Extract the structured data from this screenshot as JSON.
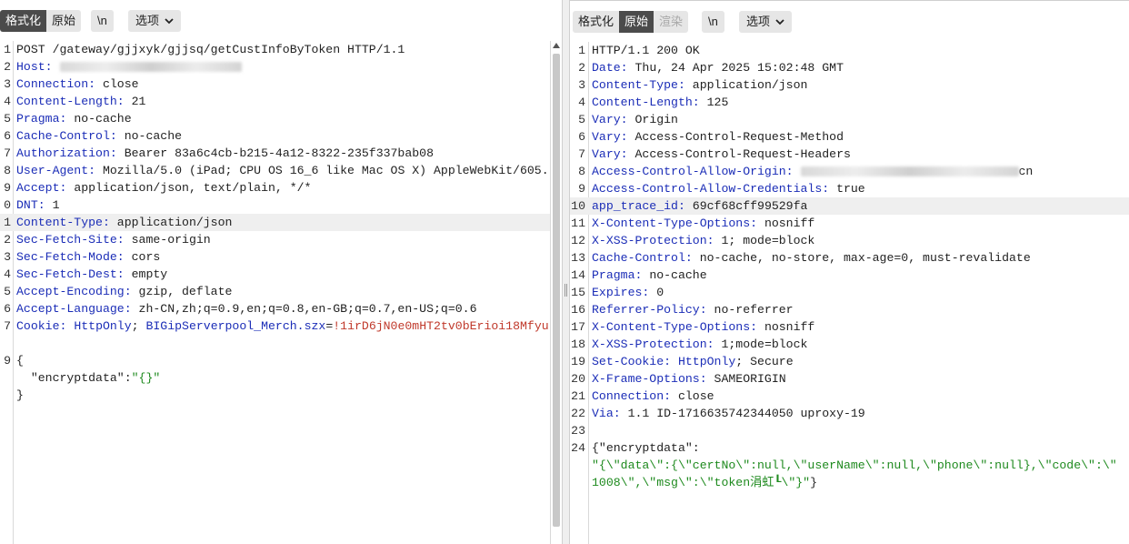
{
  "left": {
    "tabs": {
      "pretty": "格式化",
      "raw": "原始"
    },
    "newline_toggle": "\\n",
    "options": "选项",
    "lines": [
      {
        "n": "1",
        "parts": [
          {
            "t": "POST /gateway/gjjxyk/gjjsq/getCustInfoByToken HTTP/1.1",
            "c": ""
          }
        ]
      },
      {
        "n": "2",
        "parts": [
          {
            "t": "Host:",
            "c": "key"
          },
          {
            "t": " ",
            "c": ""
          },
          {
            "blur": 200
          }
        ]
      },
      {
        "n": "3",
        "parts": [
          {
            "t": "Connection:",
            "c": "key"
          },
          {
            "t": " close",
            "c": ""
          }
        ]
      },
      {
        "n": "4",
        "parts": [
          {
            "t": "Content-Length:",
            "c": "key"
          },
          {
            "t": " 21",
            "c": ""
          }
        ]
      },
      {
        "n": "5",
        "parts": [
          {
            "t": "Pragma:",
            "c": "key"
          },
          {
            "t": " no-cache",
            "c": ""
          }
        ]
      },
      {
        "n": "6",
        "parts": [
          {
            "t": "Cache-Control:",
            "c": "key"
          },
          {
            "t": " no-cache",
            "c": ""
          }
        ]
      },
      {
        "n": "7",
        "parts": [
          {
            "t": "Authorization:",
            "c": "key"
          },
          {
            "t": " Bearer 83a6c4cb-b215-4a12-8322-235f337bab08",
            "c": ""
          }
        ]
      },
      {
        "n": "8",
        "parts": [
          {
            "t": "User-Agent:",
            "c": "key"
          },
          {
            "t": " Mozilla/5.0 (iPad; CPU OS 16_6 like Mac OS X) AppleWebKit/605.",
            "c": ""
          }
        ]
      },
      {
        "n": "9",
        "parts": [
          {
            "t": "Accept:",
            "c": "key"
          },
          {
            "t": " application/json, text/plain, */*",
            "c": ""
          }
        ]
      },
      {
        "n": "0",
        "parts": [
          {
            "t": "DNT:",
            "c": "key"
          },
          {
            "t": " 1",
            "c": ""
          }
        ]
      },
      {
        "n": "1",
        "hl": true,
        "parts": [
          {
            "t": "Content-Type:",
            "c": "key"
          },
          {
            "t": " application/json",
            "c": ""
          }
        ]
      },
      {
        "n": "2",
        "parts": [
          {
            "t": "Sec-Fetch-Site:",
            "c": "key"
          },
          {
            "t": " same-origin",
            "c": ""
          }
        ]
      },
      {
        "n": "3",
        "parts": [
          {
            "t": "Sec-Fetch-Mode:",
            "c": "key"
          },
          {
            "t": " cors",
            "c": ""
          }
        ]
      },
      {
        "n": "4",
        "parts": [
          {
            "t": "Sec-Fetch-Dest:",
            "c": "key"
          },
          {
            "t": " empty",
            "c": ""
          }
        ]
      },
      {
        "n": "5",
        "parts": [
          {
            "t": "Accept-Encoding:",
            "c": "key"
          },
          {
            "t": " gzip, deflate",
            "c": ""
          }
        ]
      },
      {
        "n": "6",
        "parts": [
          {
            "t": "Accept-Language:",
            "c": "key"
          },
          {
            "t": " zh-CN,zh;q=0.9,en;q=0.8,en-GB;q=0.7,en-US;q=0.6",
            "c": ""
          }
        ]
      },
      {
        "n": "7",
        "parts": [
          {
            "t": "Cookie:",
            "c": "key"
          },
          {
            "t": " ",
            "c": ""
          },
          {
            "t": "HttpOnly",
            "c": "ck"
          },
          {
            "t": "; ",
            "c": ""
          },
          {
            "t": "BIGipServerpool_Merch.szx",
            "c": "ck"
          },
          {
            "t": "=",
            "c": ""
          },
          {
            "t": "!1irD6jN0e0mHT2tv0bErioi18Mfyu",
            "c": "cv"
          }
        ]
      },
      {
        "n": "",
        "parts": []
      },
      {
        "n": "9",
        "parts": [
          {
            "t": "{",
            "c": ""
          }
        ]
      },
      {
        "n": "",
        "parts": [
          {
            "t": "  \"encryptdata\":",
            "c": ""
          },
          {
            "t": "\"{}\"",
            "c": "str"
          }
        ]
      },
      {
        "n": "",
        "parts": [
          {
            "t": "}",
            "c": ""
          }
        ]
      }
    ]
  },
  "right": {
    "tabs": {
      "pretty": "格式化",
      "raw": "原始",
      "render": "渲染"
    },
    "newline_toggle": "\\n",
    "options": "选项",
    "lines": [
      {
        "n": "1",
        "parts": [
          {
            "t": "HTTP/1.1 200 OK",
            "c": ""
          }
        ]
      },
      {
        "n": "2",
        "parts": [
          {
            "t": "Date:",
            "c": "key"
          },
          {
            "t": " Thu, 24 Apr 2025 15:02:48 GMT",
            "c": ""
          }
        ]
      },
      {
        "n": "3",
        "parts": [
          {
            "t": "Content-Type:",
            "c": "key"
          },
          {
            "t": " application/json",
            "c": ""
          }
        ]
      },
      {
        "n": "4",
        "parts": [
          {
            "t": "Content-Length:",
            "c": "key"
          },
          {
            "t": " 125",
            "c": ""
          }
        ]
      },
      {
        "n": "5",
        "parts": [
          {
            "t": "Vary:",
            "c": "key"
          },
          {
            "t": " Origin",
            "c": ""
          }
        ]
      },
      {
        "n": "6",
        "parts": [
          {
            "t": "Vary:",
            "c": "key"
          },
          {
            "t": " Access-Control-Request-Method",
            "c": ""
          }
        ]
      },
      {
        "n": "7",
        "parts": [
          {
            "t": "Vary:",
            "c": "key"
          },
          {
            "t": " Access-Control-Request-Headers",
            "c": ""
          }
        ]
      },
      {
        "n": "8",
        "parts": [
          {
            "t": "Access-Control-Allow-Origin:",
            "c": "key"
          },
          {
            "t": " ",
            "c": ""
          },
          {
            "blur": 240
          },
          {
            "t": "cn",
            "c": ""
          }
        ]
      },
      {
        "n": "9",
        "parts": [
          {
            "t": "Access-Control-Allow-Credentials:",
            "c": "key"
          },
          {
            "t": " true",
            "c": ""
          }
        ]
      },
      {
        "n": "10",
        "hl": true,
        "parts": [
          {
            "t": "app_trace_id:",
            "c": "key"
          },
          {
            "t": " 69cf68cff99529fa",
            "c": ""
          }
        ]
      },
      {
        "n": "11",
        "parts": [
          {
            "t": "X-Content-Type-Options:",
            "c": "key"
          },
          {
            "t": " nosniff",
            "c": ""
          }
        ]
      },
      {
        "n": "12",
        "parts": [
          {
            "t": "X-XSS-Protection:",
            "c": "key"
          },
          {
            "t": " 1; mode=block",
            "c": ""
          }
        ]
      },
      {
        "n": "13",
        "parts": [
          {
            "t": "Cache-Control:",
            "c": "key"
          },
          {
            "t": " no-cache, no-store, max-age=0, must-revalidate",
            "c": ""
          }
        ]
      },
      {
        "n": "14",
        "parts": [
          {
            "t": "Pragma:",
            "c": "key"
          },
          {
            "t": " no-cache",
            "c": ""
          }
        ]
      },
      {
        "n": "15",
        "parts": [
          {
            "t": "Expires:",
            "c": "key"
          },
          {
            "t": " 0",
            "c": ""
          }
        ]
      },
      {
        "n": "16",
        "parts": [
          {
            "t": "Referrer-Policy:",
            "c": "key"
          },
          {
            "t": " no-referrer",
            "c": ""
          }
        ]
      },
      {
        "n": "17",
        "parts": [
          {
            "t": "X-Content-Type-Options:",
            "c": "key"
          },
          {
            "t": " nosniff",
            "c": ""
          }
        ]
      },
      {
        "n": "18",
        "parts": [
          {
            "t": "X-XSS-Protection:",
            "c": "key"
          },
          {
            "t": " 1;mode=block",
            "c": ""
          }
        ]
      },
      {
        "n": "19",
        "parts": [
          {
            "t": "Set-Cookie:",
            "c": "key"
          },
          {
            "t": " ",
            "c": ""
          },
          {
            "t": "HttpOnly",
            "c": "ck"
          },
          {
            "t": "; Secure",
            "c": ""
          }
        ]
      },
      {
        "n": "20",
        "parts": [
          {
            "t": "X-Frame-Options:",
            "c": "key"
          },
          {
            "t": " SAMEORIGIN",
            "c": ""
          }
        ]
      },
      {
        "n": "21",
        "parts": [
          {
            "t": "Connection:",
            "c": "key"
          },
          {
            "t": " close",
            "c": ""
          }
        ]
      },
      {
        "n": "22",
        "parts": [
          {
            "t": "Via:",
            "c": "key"
          },
          {
            "t": " 1.1 ID-1716635742344050 uproxy-19",
            "c": ""
          }
        ]
      },
      {
        "n": "23",
        "parts": []
      },
      {
        "n": "24",
        "parts": [
          {
            "t": "{\"encryptdata\":",
            "c": ""
          }
        ]
      },
      {
        "n": "",
        "parts": [
          {
            "t": "\"{\\\"data\\\":{\\\"certNo\\\":null,\\\"userName\\\":null,\\\"phone\\\":null},\\\"code\\\":\\\"",
            "c": "str"
          }
        ]
      },
      {
        "n": "",
        "parts": [
          {
            "t": "1008\\\",\\\"msg\\\":\\\"token涓虹┖\\\"}\"",
            "c": "str"
          },
          {
            "t": "}",
            "c": ""
          }
        ]
      }
    ]
  }
}
